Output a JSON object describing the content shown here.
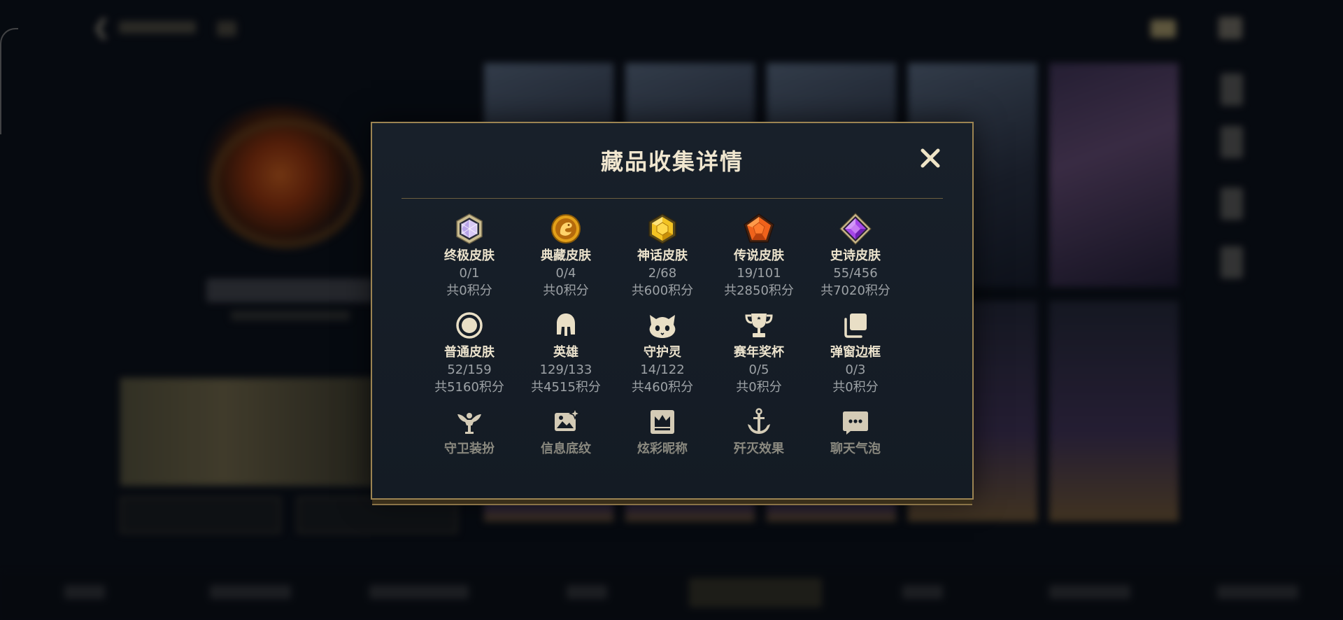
{
  "modal": {
    "title": "藏品收集详情",
    "close_label": "✕"
  },
  "categories": [
    {
      "name": "终极皮肤",
      "count": "0/1",
      "points": "共0积分",
      "icon": "ultimate-gem-icon"
    },
    {
      "name": "典藏皮肤",
      "count": "0/4",
      "points": "共0积分",
      "icon": "dragon-coin-icon"
    },
    {
      "name": "神话皮肤",
      "count": "2/68",
      "points": "共600积分",
      "icon": "mythic-gem-icon"
    },
    {
      "name": "传说皮肤",
      "count": "19/101",
      "points": "共2850积分",
      "icon": "legendary-gem-icon"
    },
    {
      "name": "史诗皮肤",
      "count": "55/456",
      "points": "共7020积分",
      "icon": "epic-gem-icon"
    },
    {
      "name": "普通皮肤",
      "count": "52/159",
      "points": "共5160积分",
      "icon": "circle-icon"
    },
    {
      "name": "英雄",
      "count": "129/133",
      "points": "共4515积分",
      "icon": "helmet-icon"
    },
    {
      "name": "守护灵",
      "count": "14/122",
      "points": "共460积分",
      "icon": "creature-icon"
    },
    {
      "name": "赛年奖杯",
      "count": "0/5",
      "points": "共0积分",
      "icon": "trophy-icon"
    },
    {
      "name": "弹窗边框",
      "count": "0/3",
      "points": "共0积分",
      "icon": "frames-icon"
    },
    {
      "name": "守卫装扮",
      "icon": "ward-icon"
    },
    {
      "name": "信息底纹",
      "icon": "image-sparkle-icon"
    },
    {
      "name": "炫彩昵称",
      "icon": "crown-card-icon"
    },
    {
      "name": "歼灭效果",
      "icon": "anchor-sword-icon"
    },
    {
      "name": "聊天气泡",
      "icon": "chat-bubble-icon"
    }
  ],
  "colors": {
    "gold_border": "#9c8452",
    "title": "#f0e6cf",
    "muted_text": "#9da2a6",
    "icon_cream": "#e9dfc6"
  }
}
